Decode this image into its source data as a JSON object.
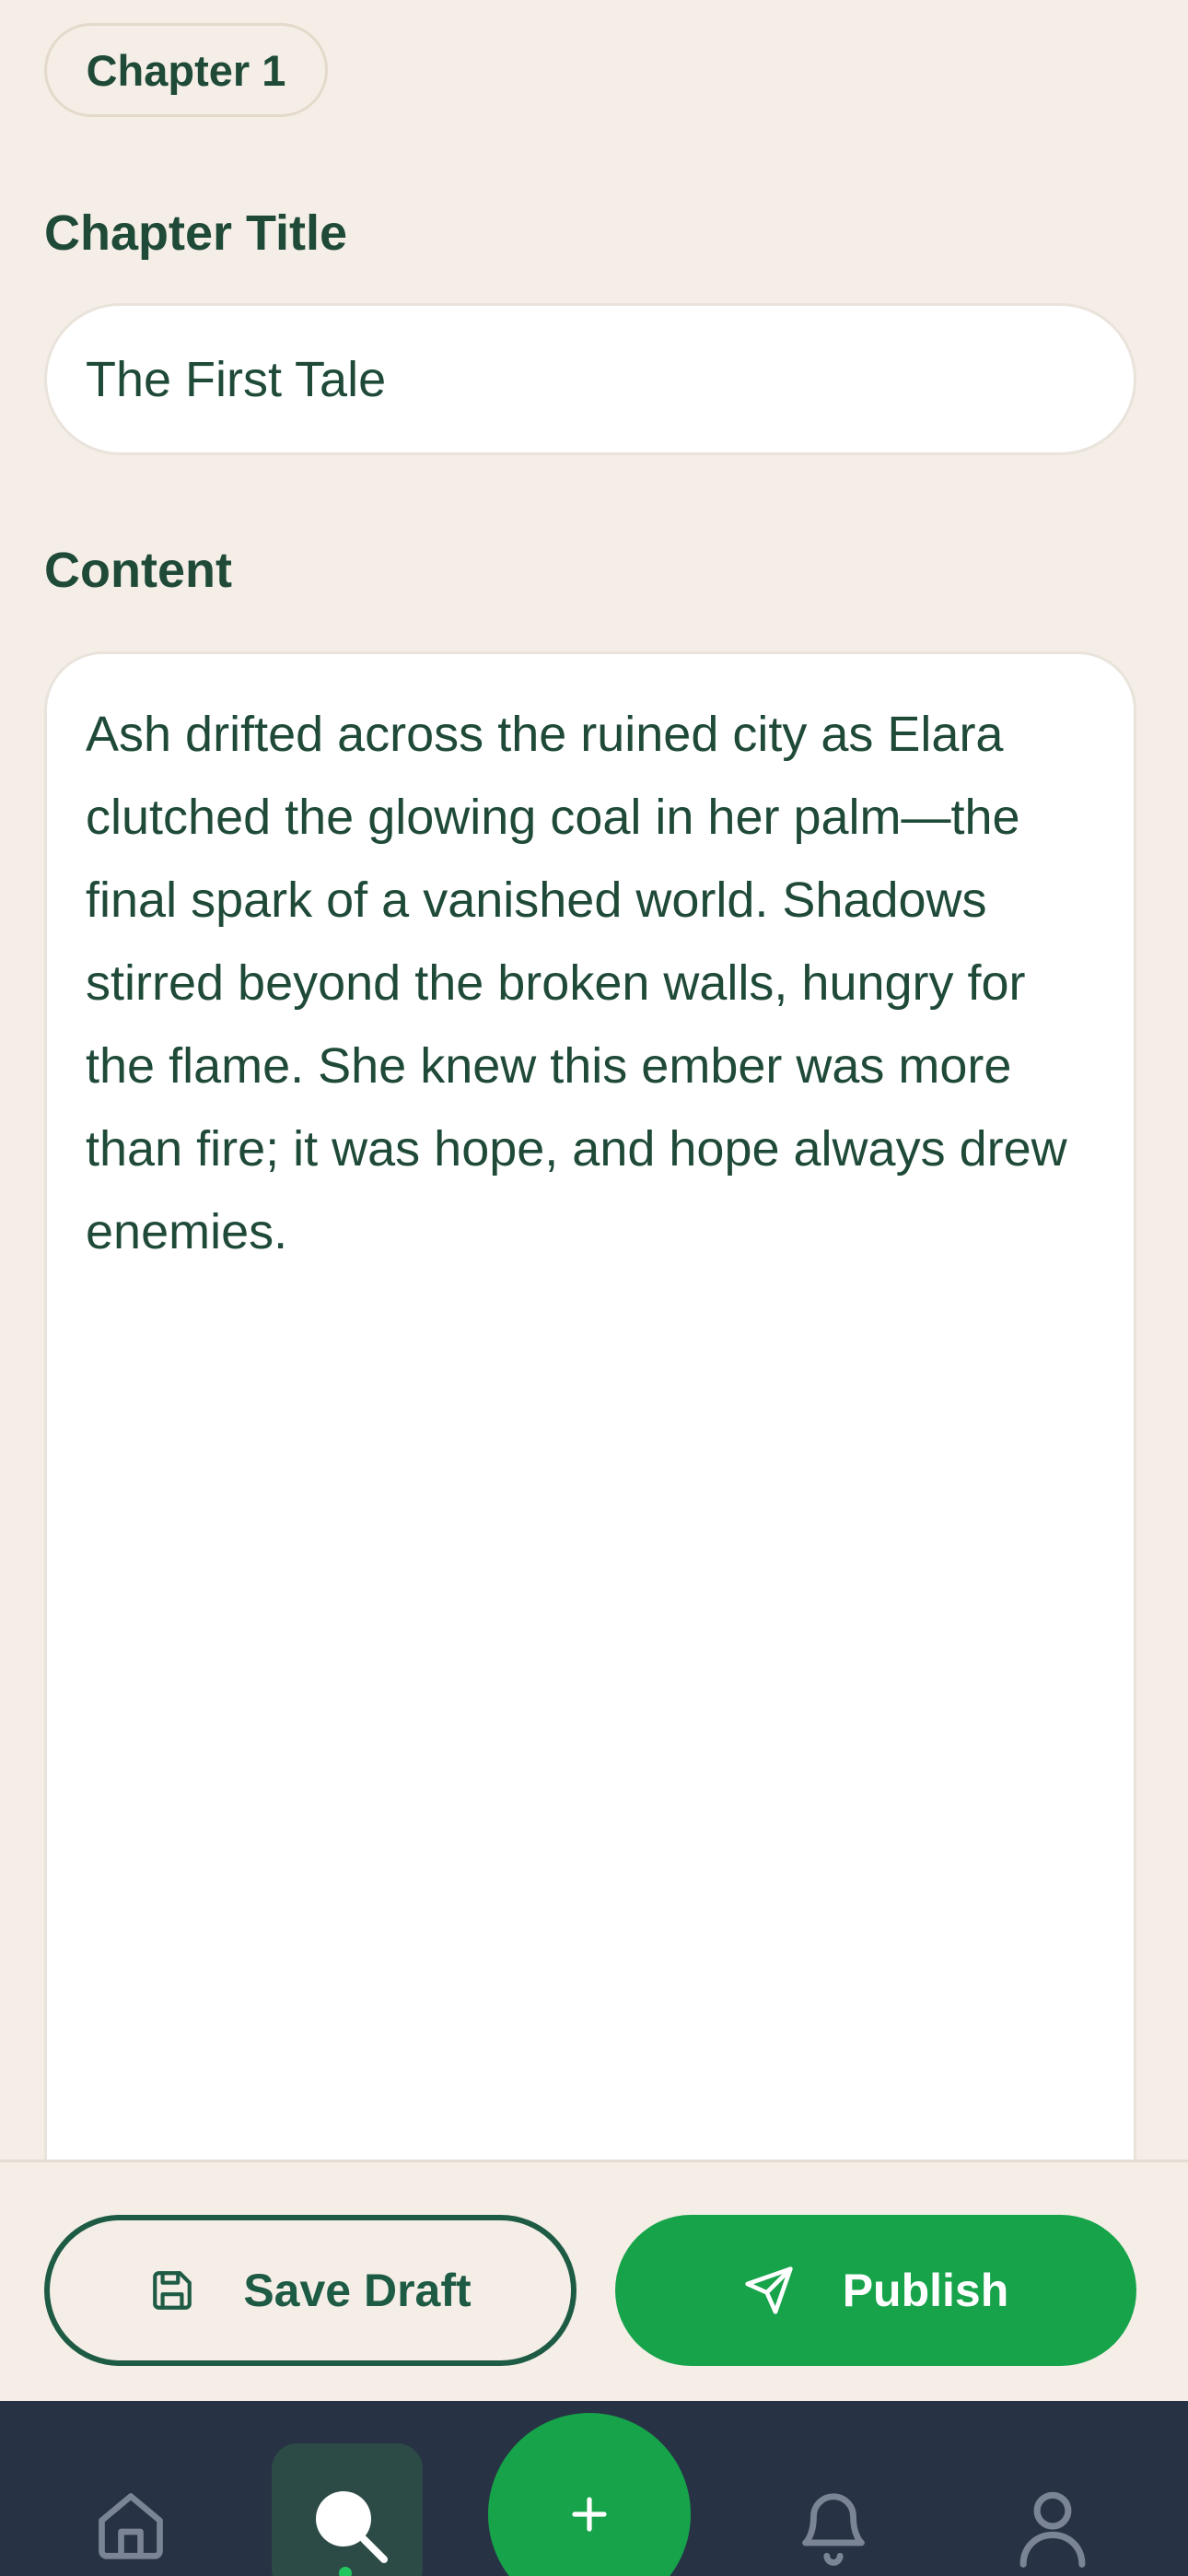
{
  "chapter": {
    "badge": "Chapter 1"
  },
  "title_field": {
    "label": "Chapter Title",
    "value": "The First Tale"
  },
  "content_field": {
    "label": "Content",
    "value": "Ash drifted across the ruined city as Elara clutched the glowing coal in her palm—the final spark of a vanished world. Shadows stirred beyond the broken walls, hungry for the flame. She knew this ember was more than fire; it was hope, and hope always drew enemies."
  },
  "actions": {
    "save_draft": "Save Draft",
    "publish": "Publish"
  },
  "nav": {
    "items": [
      {
        "icon": "home-icon",
        "active": false
      },
      {
        "icon": "search-icon",
        "active": true
      },
      {
        "icon": "plus-icon",
        "active": false
      },
      {
        "icon": "bell-icon",
        "active": false
      },
      {
        "icon": "profile-icon",
        "active": false
      }
    ]
  },
  "colors": {
    "background": "#F5EEE7",
    "text": "#1F4A38",
    "primary": "#16A34A",
    "nav_background": "#273244",
    "nav_active": "#2C4B47"
  }
}
